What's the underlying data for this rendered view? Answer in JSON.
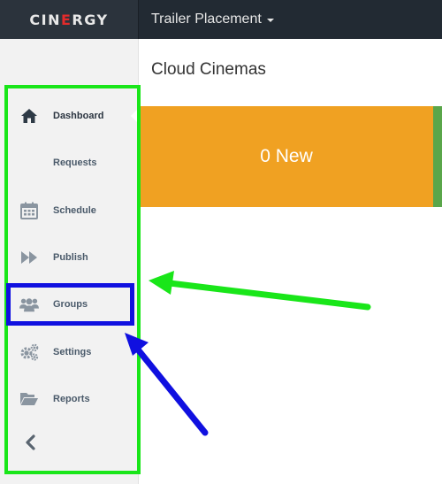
{
  "app": {
    "logo": "CINERGY",
    "logo_prefix": "CIN",
    "logo_accent": "E",
    "logo_suffix": "RGY"
  },
  "topnav": {
    "dropdown_label": "Trailer Placement"
  },
  "sidebar": {
    "items": [
      {
        "label": "Dashboard",
        "icon": "home-icon",
        "active": true
      },
      {
        "label": "Requests",
        "icon": ""
      },
      {
        "label": "Schedule",
        "icon": "calendar-icon"
      },
      {
        "label": "Publish",
        "icon": "fast-forward-icon"
      },
      {
        "label": "Groups",
        "icon": "users-icon"
      },
      {
        "label": "Settings",
        "icon": "gears-icon"
      },
      {
        "label": "Reports",
        "icon": "folder-open-icon"
      }
    ],
    "collapse_icon": "chevron-left-icon"
  },
  "main": {
    "title": "Cloud Cinemas",
    "tile": {
      "label": "0 New",
      "color": "#f0a122"
    }
  },
  "colors": {
    "topbar": "#222a33",
    "accent": "#e32b2b",
    "highlight_green": "#19e619",
    "highlight_blue": "#1010e0",
    "tile_green": "#5aa64a"
  }
}
